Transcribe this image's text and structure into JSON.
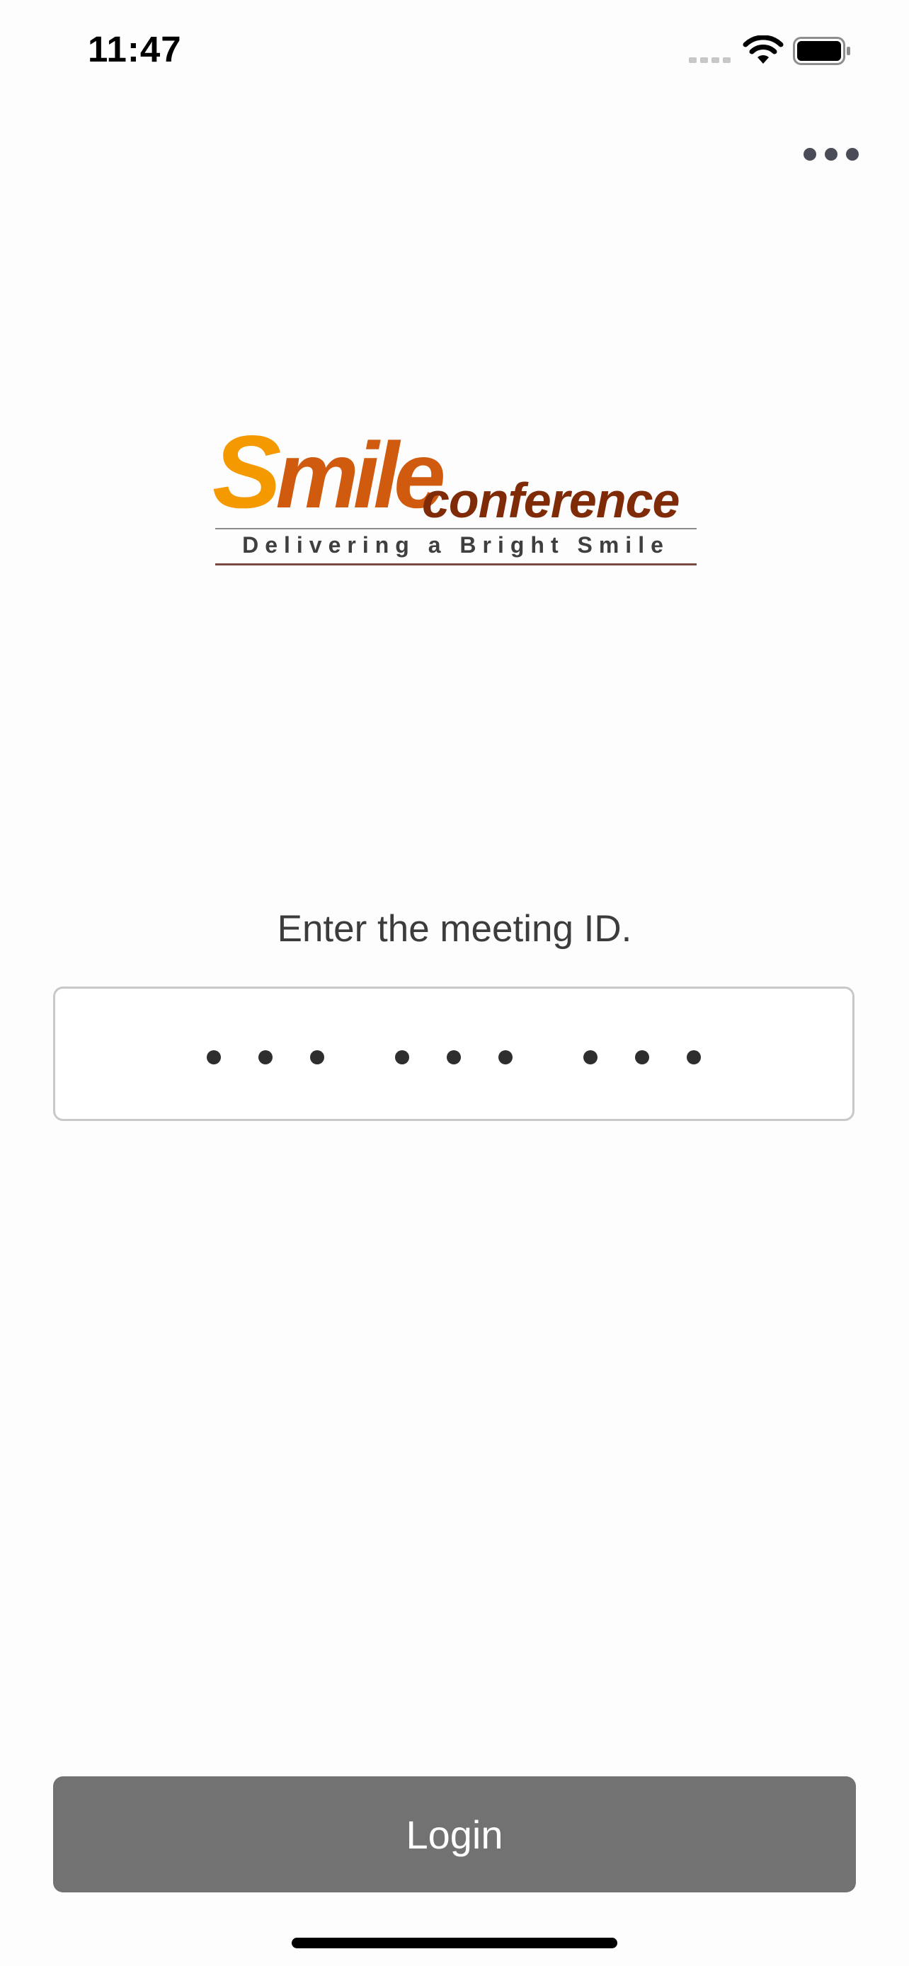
{
  "status_bar": {
    "time": "11:47",
    "icons": [
      "cellular-signal-icon",
      "wifi-icon",
      "battery-icon"
    ]
  },
  "header": {
    "more_icon": "ellipsis-icon"
  },
  "logo": {
    "word_s": "S",
    "word_mile": "mile",
    "word_conference": "conference",
    "tagline": "Delivering a Bright Smile"
  },
  "form": {
    "prompt": "Enter the meeting ID.",
    "meeting_id_masked_length": 9,
    "meeting_id_group_size": 3
  },
  "actions": {
    "login_label": "Login"
  },
  "colors": {
    "logo_s": "#f59900",
    "logo_mile": "#d05a0e",
    "logo_conference": "#7f2b08",
    "login_button": "#727272",
    "field_border": "#c8c8c8"
  }
}
